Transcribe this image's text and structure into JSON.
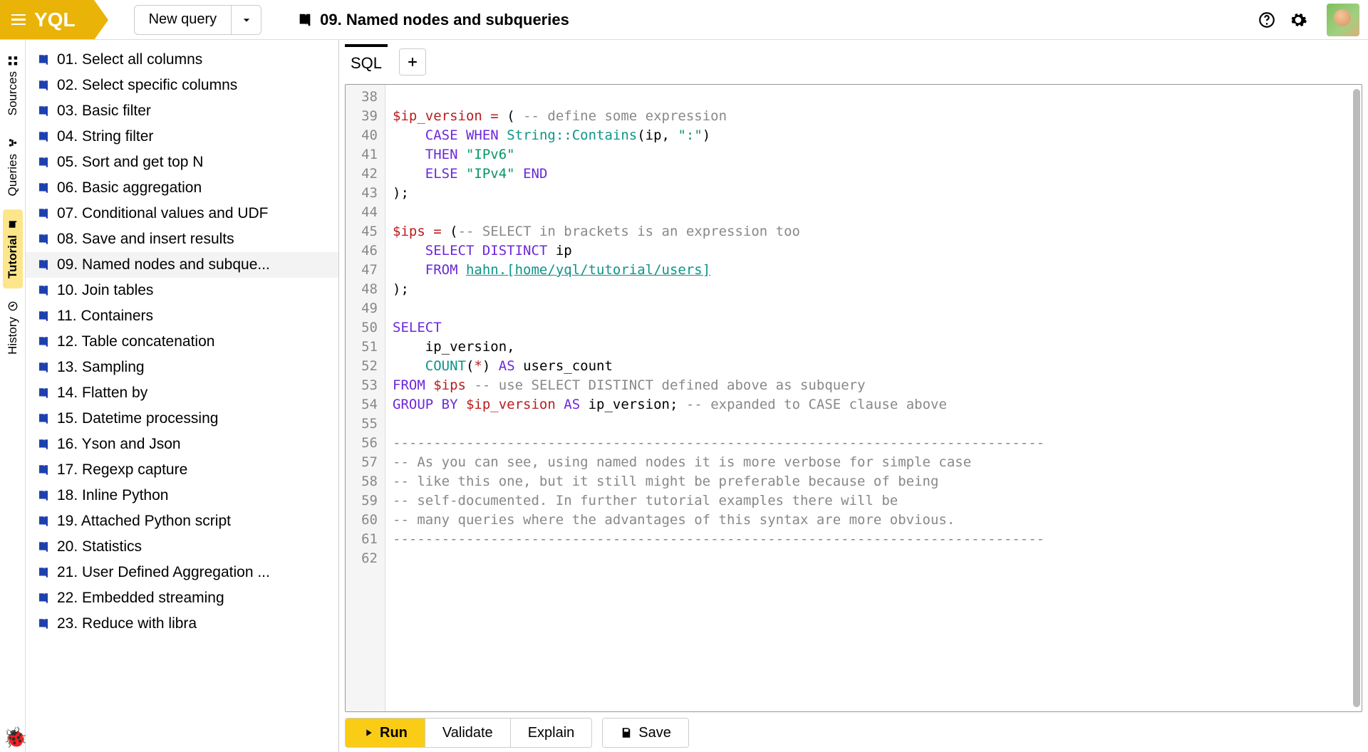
{
  "brand": {
    "name": "YQL"
  },
  "topbar": {
    "new_query_label": "New query",
    "page_title": "09. Named nodes and subqueries"
  },
  "rail_tabs": [
    {
      "id": "sources",
      "label": "Sources",
      "icon": "grid-icon",
      "active": false
    },
    {
      "id": "queries",
      "label": "Queries",
      "icon": "tree-icon",
      "active": false
    },
    {
      "id": "tutorial",
      "label": "Tutorial",
      "icon": "book-icon",
      "active": true
    },
    {
      "id": "history",
      "label": "History",
      "icon": "clock-icon",
      "active": false
    }
  ],
  "tutorials": [
    "01. Select all columns",
    "02. Select specific columns",
    "03. Basic filter",
    "04. String filter",
    "05. Sort and get top N",
    "06. Basic aggregation",
    "07. Conditional values and UDF",
    "08. Save and insert results",
    "09. Named nodes and subque...",
    "10. Join tables",
    "11. Containers",
    "12. Table concatenation",
    "13. Sampling",
    "14. Flatten by",
    "15. Datetime processing",
    "16. Yson and Json",
    "17. Regexp capture",
    "18. Inline Python",
    "19. Attached Python script",
    "20. Statistics",
    "21. User Defined Aggregation ...",
    "22. Embedded streaming",
    "23. Reduce with libra"
  ],
  "active_tutorial_index": 8,
  "editor": {
    "tabs": [
      {
        "label": "SQL",
        "active": true
      }
    ],
    "first_line": 38,
    "lines": [
      [],
      [
        {
          "t": "var",
          "v": "$ip_version"
        },
        {
          "t": "",
          "v": " "
        },
        {
          "t": "op",
          "v": "="
        },
        {
          "t": "",
          "v": " ( "
        },
        {
          "t": "cmt",
          "v": "-- define some expression"
        }
      ],
      [
        {
          "t": "",
          "v": "    "
        },
        {
          "t": "kw",
          "v": "CASE"
        },
        {
          "t": "",
          "v": " "
        },
        {
          "t": "kw",
          "v": "WHEN"
        },
        {
          "t": "",
          "v": " "
        },
        {
          "t": "fn",
          "v": "String::Contains"
        },
        {
          "t": "",
          "v": "(ip, "
        },
        {
          "t": "str",
          "v": "\":\""
        },
        {
          "t": "",
          "v": ")"
        }
      ],
      [
        {
          "t": "",
          "v": "    "
        },
        {
          "t": "kw",
          "v": "THEN"
        },
        {
          "t": "",
          "v": " "
        },
        {
          "t": "str",
          "v": "\"IPv6\""
        }
      ],
      [
        {
          "t": "",
          "v": "    "
        },
        {
          "t": "kw",
          "v": "ELSE"
        },
        {
          "t": "",
          "v": " "
        },
        {
          "t": "str",
          "v": "\"IPv4\""
        },
        {
          "t": "",
          "v": " "
        },
        {
          "t": "kw",
          "v": "END"
        }
      ],
      [
        {
          "t": "",
          "v": ");"
        }
      ],
      [],
      [
        {
          "t": "var",
          "v": "$ips"
        },
        {
          "t": "",
          "v": " "
        },
        {
          "t": "op",
          "v": "="
        },
        {
          "t": "",
          "v": " ("
        },
        {
          "t": "cmt",
          "v": "-- SELECT in brackets is an expression too"
        }
      ],
      [
        {
          "t": "",
          "v": "    "
        },
        {
          "t": "kw",
          "v": "SELECT"
        },
        {
          "t": "",
          "v": " "
        },
        {
          "t": "kw",
          "v": "DISTINCT"
        },
        {
          "t": "",
          "v": " ip"
        }
      ],
      [
        {
          "t": "",
          "v": "    "
        },
        {
          "t": "kw",
          "v": "FROM"
        },
        {
          "t": "",
          "v": " "
        },
        {
          "t": "link",
          "v": "hahn.[home/yql/tutorial/users]"
        }
      ],
      [
        {
          "t": "",
          "v": ");"
        }
      ],
      [],
      [
        {
          "t": "kw",
          "v": "SELECT"
        }
      ],
      [
        {
          "t": "",
          "v": "    ip_version,"
        }
      ],
      [
        {
          "t": "",
          "v": "    "
        },
        {
          "t": "fn",
          "v": "COUNT"
        },
        {
          "t": "",
          "v": "("
        },
        {
          "t": "op",
          "v": "*"
        },
        {
          "t": "",
          "v": ") "
        },
        {
          "t": "kw",
          "v": "AS"
        },
        {
          "t": "",
          "v": " users_count"
        }
      ],
      [
        {
          "t": "kw",
          "v": "FROM"
        },
        {
          "t": "",
          "v": " "
        },
        {
          "t": "var",
          "v": "$ips"
        },
        {
          "t": "",
          "v": " "
        },
        {
          "t": "cmt",
          "v": "-- use SELECT DISTINCT defined above as subquery"
        }
      ],
      [
        {
          "t": "kw",
          "v": "GROUP BY"
        },
        {
          "t": "",
          "v": " "
        },
        {
          "t": "var",
          "v": "$ip_version"
        },
        {
          "t": "",
          "v": " "
        },
        {
          "t": "kw",
          "v": "AS"
        },
        {
          "t": "",
          "v": " ip_version; "
        },
        {
          "t": "cmt",
          "v": "-- expanded to CASE clause above"
        }
      ],
      [],
      [
        {
          "t": "cmt",
          "v": "--------------------------------------------------------------------------------"
        }
      ],
      [
        {
          "t": "cmt",
          "v": "-- As you can see, using named nodes it is more verbose for simple case"
        }
      ],
      [
        {
          "t": "cmt",
          "v": "-- like this one, but it still might be preferable because of being"
        }
      ],
      [
        {
          "t": "cmt",
          "v": "-- self-documented. In further tutorial examples there will be"
        }
      ],
      [
        {
          "t": "cmt",
          "v": "-- many queries where the advantages of this syntax are more obvious."
        }
      ],
      [
        {
          "t": "cmt",
          "v": "--------------------------------------------------------------------------------"
        }
      ],
      []
    ]
  },
  "actions": {
    "run": "Run",
    "validate": "Validate",
    "explain": "Explain",
    "save": "Save"
  }
}
